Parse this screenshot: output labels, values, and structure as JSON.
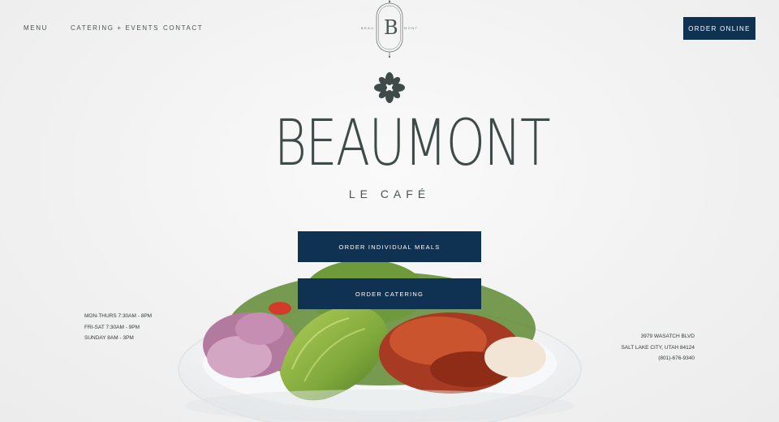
{
  "nav": {
    "items": [
      {
        "label": "MENU"
      },
      {
        "label": "CATERING + EVENTS"
      },
      {
        "label": "CONTACT"
      }
    ],
    "order_online": "ORDER ONLINE"
  },
  "logo": {
    "monogram_letter": "B",
    "left_text": "BEAU",
    "right_text": "MONT",
    "icon": "flower-icon"
  },
  "brand": {
    "title": "BEAUMONT",
    "subtitle": "LE CAFÉ"
  },
  "cta": {
    "individual": "ORDER INDIVIDUAL MEALS",
    "catering": "ORDER CATERING"
  },
  "hours": [
    "MON-THURS 7:30AM - 8PM",
    "FRI-SAT 7:30AM - 9PM",
    "SUNDAY 8AM - 3PM"
  ],
  "address": [
    "3979 WASATCH BLVD",
    "SALT LAKE CITY, UTAH 84124",
    "(801)-676-9340"
  ],
  "colors": {
    "accent": "#0f3253",
    "text": "#3f4b49",
    "background": "#f3f3f3"
  }
}
